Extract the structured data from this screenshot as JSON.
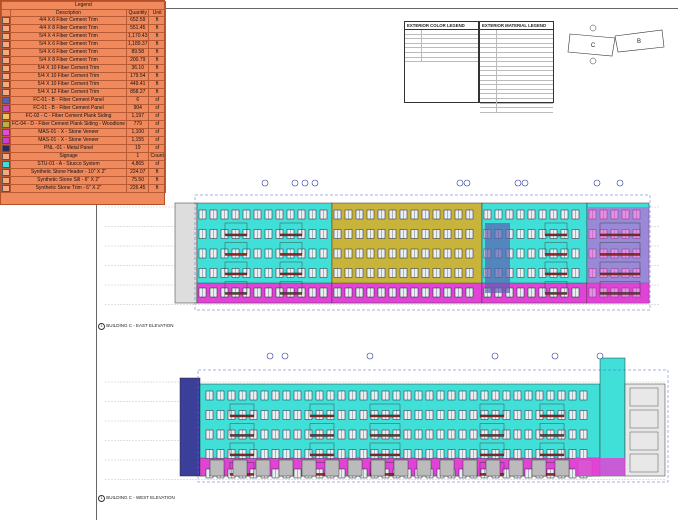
{
  "legend": {
    "title": "Legend",
    "headers": [
      "Description",
      "Quantity",
      "Unit"
    ],
    "rows": [
      {
        "desc": "4/4 X 6 Fiber Cement Trim",
        "qty": "652.59",
        "unit": "ft",
        "color": "#f5a882"
      },
      {
        "desc": "4/4 X 8 Fiber Cement Trim",
        "qty": "551.45",
        "unit": "ft",
        "color": "#f5a882"
      },
      {
        "desc": "5/4 X 4 Fiber Cement Trim",
        "qty": "1,170.43",
        "unit": "ft",
        "color": "#f5a882"
      },
      {
        "desc": "5/4 X 6 Fiber Cement Trim",
        "qty": "1,189.37",
        "unit": "ft",
        "color": "#f5a882"
      },
      {
        "desc": "5/4 X 6 Fiber Cement Trim",
        "qty": "89.58",
        "unit": "ft",
        "color": "#f5a882"
      },
      {
        "desc": "5/4 X 8 Fiber Cement Trim",
        "qty": "200.79",
        "unit": "ft",
        "color": "#f5a882"
      },
      {
        "desc": "5/4 X 10 Fiber Cement Trim",
        "qty": "36.10",
        "unit": "ft",
        "color": "#f5a882"
      },
      {
        "desc": "5/4 X 10 Fiber Cement Trim",
        "qty": "179.54",
        "unit": "ft",
        "color": "#f5a882"
      },
      {
        "desc": "5/4 X 10 Fiber Cement Trim",
        "qty": "449.41",
        "unit": "ft",
        "color": "#f5a882"
      },
      {
        "desc": "5/4 X 12 Fiber Cement Trim",
        "qty": "858.27",
        "unit": "ft",
        "color": "#f5a882"
      },
      {
        "desc": "FC-01 - B - Fiber Cement Panel",
        "qty": "6",
        "unit": "sf",
        "color": "#5a5fb0"
      },
      {
        "desc": "FC-01 - B - Fiber Cement Panel",
        "qty": "904",
        "unit": "sf",
        "color": "#c94ab8"
      },
      {
        "desc": "FC-02 - C - Fiber Cement Plank Siding",
        "qty": "1,197",
        "unit": "sf",
        "color": "#f0c060"
      },
      {
        "desc": "FC-04 - D - Fiber Cement Plank Siding - Woodtone",
        "qty": "779",
        "unit": "sf",
        "color": "#b8b040"
      },
      {
        "desc": "MAS-01 - X - Stone Veneer",
        "qty": "1,100",
        "unit": "sf",
        "color": "#e84ad8"
      },
      {
        "desc": "MAS-01 - X - Stone Veneer",
        "qty": "1,155",
        "unit": "sf",
        "color": "#d03ad0"
      },
      {
        "desc": "PNL -01 - Metal Panel",
        "qty": "19",
        "unit": "sf",
        "color": "#2a2a5a"
      },
      {
        "desc": "Signage",
        "qty": "1",
        "unit": "Count",
        "color": "#f5a882"
      },
      {
        "desc": "STU-01 - A - Stucco System",
        "qty": "4,865",
        "unit": "sf",
        "color": "#40e0d8"
      },
      {
        "desc": "Synthetic Stone Header - 10\" X 2\"",
        "qty": "224.07",
        "unit": "ft",
        "color": "#f5a882"
      },
      {
        "desc": "Synthetic Stone Sill - 6\" X 2\"",
        "qty": "75.50",
        "unit": "ft",
        "color": "#f5a882"
      },
      {
        "desc": "Synthetic Stone Trim - 6\" X 2\"",
        "qty": "226.45",
        "unit": "ft",
        "color": "#f5a882"
      }
    ]
  },
  "color_legend": {
    "title": "EXTERIOR COLOR LEGEND"
  },
  "material_legend": {
    "title": "EXTERIOR MATERIAL LEGEND"
  },
  "key_plan": {
    "label_c": "C",
    "label_b": "B"
  },
  "elevations": {
    "east_title": "BUILDING C - EAST ELEVATION",
    "west_title": "BUILDING C - WEST ELEVATION",
    "number": "1"
  },
  "colors": {
    "stucco": "#40e0d8",
    "stone": "#e043d6",
    "siding": "#c8b43a",
    "panel": "#5a5fb0",
    "trim": "#f08a5d"
  }
}
